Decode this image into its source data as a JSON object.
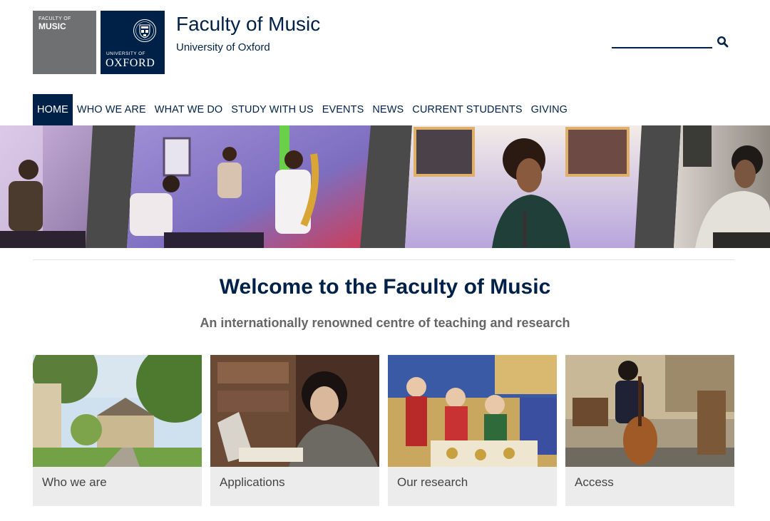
{
  "header": {
    "faculty_logo_small": "FACULTY OF",
    "faculty_logo_large": "MUSIC",
    "oxford_logo_small": "UNIVERSITY OF",
    "oxford_logo_large": "OXFORD",
    "title": "Faculty of Music",
    "subtitle": "University of Oxford"
  },
  "search": {
    "placeholder": "",
    "icon": "search-icon"
  },
  "nav": {
    "items": [
      {
        "label": "HOME",
        "active": true
      },
      {
        "label": "WHO WE ARE"
      },
      {
        "label": "WHAT WE DO"
      },
      {
        "label": "STUDY WITH US"
      },
      {
        "label": "EVENTS"
      },
      {
        "label": "NEWS"
      },
      {
        "label": "CURRENT STUDENTS"
      },
      {
        "label": "GIVING"
      }
    ]
  },
  "main": {
    "heading": "Welcome to the Faculty of Music",
    "tagline": "An internationally renowned centre of teaching and research"
  },
  "cards": [
    {
      "label": "Who we are"
    },
    {
      "label": "Applications"
    },
    {
      "label": "Our research"
    },
    {
      "label": "Access"
    }
  ],
  "colors": {
    "oxford_blue": "#002147",
    "logo_grey": "#6f7072",
    "card_caption_bg": "#ececec",
    "tagline_grey": "#666666"
  }
}
